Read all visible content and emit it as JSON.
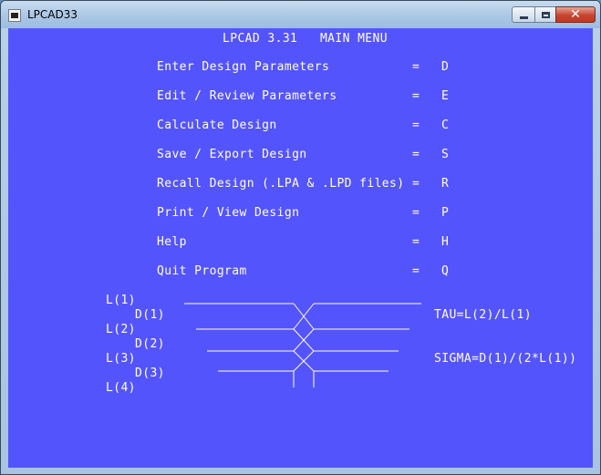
{
  "window": {
    "title": "LPCAD33"
  },
  "menu": {
    "heading": "LPCAD 3.31   MAIN MENU",
    "items": [
      {
        "label": "Enter Design Parameters",
        "eq": "=",
        "key": "D"
      },
      {
        "label": "Edit / Review Parameters",
        "eq": "=",
        "key": "E"
      },
      {
        "label": "Calculate Design",
        "eq": "=",
        "key": "C"
      },
      {
        "label": "Save / Export Design",
        "eq": "=",
        "key": "S"
      },
      {
        "label": "Recall Design (.LPA & .LPD files)",
        "eq": "=",
        "key": "R"
      },
      {
        "label": "Print / View Design",
        "eq": "=",
        "key": "P"
      },
      {
        "label": "Help",
        "eq": "=",
        "key": "H"
      },
      {
        "label": "Quit Program",
        "eq": "=",
        "key": "Q"
      }
    ]
  },
  "diagram": {
    "labels": {
      "l1": "L(1)",
      "d1": "D(1)",
      "l2": "L(2)",
      "d2": "D(2)",
      "l3": "L(3)",
      "d3": "D(3)",
      "l4": "L(4)"
    },
    "tau": "TAU=L(2)/L(1)",
    "sigma": "SIGMA=D(1)/(2*L(1))"
  }
}
